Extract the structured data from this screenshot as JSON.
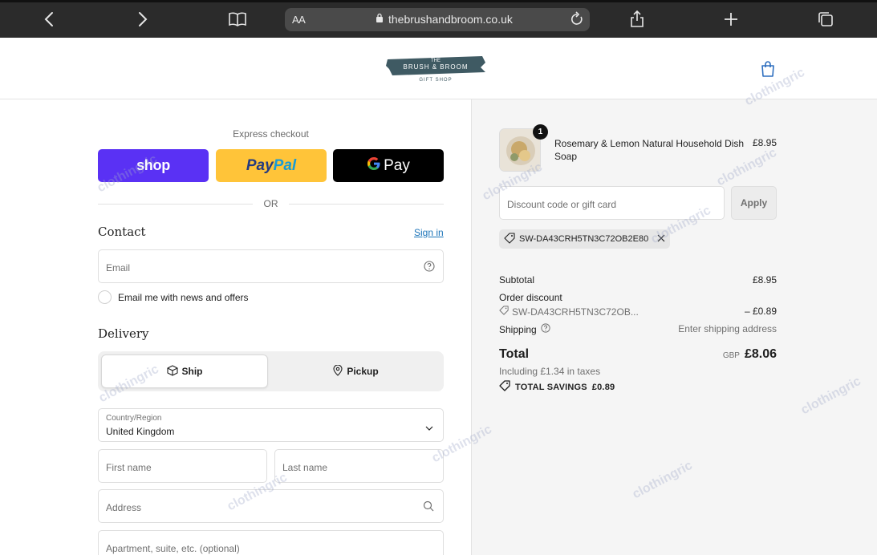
{
  "browser": {
    "url": "thebrushandbroom.co.uk",
    "text_size_label": "AA"
  },
  "store": {
    "logo_line1": "THE",
    "logo_line2": "BRUSH & BROOM",
    "logo_line3": "GIFT SHOP"
  },
  "express": {
    "label": "Express checkout",
    "shop_label": "shop",
    "paypal_label_1": "Pay",
    "paypal_label_2": "Pal",
    "gpay_label": "Pay",
    "or_label": "OR"
  },
  "contact": {
    "title": "Contact",
    "sign_in": "Sign in",
    "email_placeholder": "Email",
    "newsletter_label": "Email me with news and offers"
  },
  "delivery": {
    "title": "Delivery",
    "ship_label": "Ship",
    "pickup_label": "Pickup",
    "country_label": "Country/Region",
    "country_value": "United Kingdom",
    "first_name_placeholder": "First name",
    "last_name_placeholder": "Last name",
    "address_placeholder": "Address",
    "apartment_placeholder": "Apartment, suite, etc. (optional)"
  },
  "order": {
    "product_name": "Rosemary & Lemon Natural Household Dish Soap",
    "product_price": "£8.95",
    "quantity": "1",
    "discount_placeholder": "Discount code or gift card",
    "apply_label": "Apply",
    "applied_code": "SW-DA43CRH5TN3C72OB2E80",
    "subtotal_label": "Subtotal",
    "subtotal_value": "£8.95",
    "order_discount_label": "Order discount",
    "discount_code_truncated": "SW-DA43CRH5TN3C72OB...",
    "discount_value": "– £0.89",
    "shipping_label": "Shipping",
    "shipping_value": "Enter shipping address",
    "total_label": "Total",
    "total_currency": "GBP",
    "total_value": "£8.06",
    "taxes_note": "Including £1.34 in taxes",
    "savings_label": "TOTAL SAVINGS",
    "savings_value": "£0.89"
  },
  "watermark": "clothingric",
  "colors": {
    "shop_purple": "#5a31f4",
    "paypal_yellow": "#ffc439",
    "link_blue": "#1a73b8"
  }
}
